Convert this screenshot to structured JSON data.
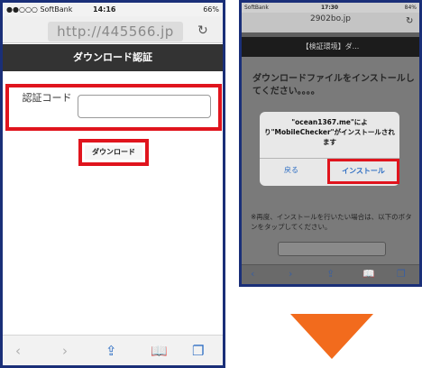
{
  "colors": {
    "highlight": "#e0141d",
    "phone_frame": "#1a2f78",
    "arrow": "#f26b1d",
    "link": "#2f6fc4"
  },
  "left_phone": {
    "status": {
      "carrier": "●●○○○ SoftBank",
      "time": "14:16",
      "battery": "66%"
    },
    "url": "http://445566.jp",
    "reload_icon": "reload-icon",
    "title": "ダウンロード認証",
    "form": {
      "label": "認証コード",
      "input_value": ""
    },
    "download_button": "ダウンロード",
    "toolbar_icons": [
      "back-icon",
      "forward-icon",
      "share-icon",
      "bookmarks-icon",
      "tabs-icon"
    ]
  },
  "right_phone": {
    "status": {
      "carrier": "SoftBank",
      "time": "17:30",
      "battery": "84%"
    },
    "url": "2902bo.jp",
    "title": "【検証環境】ダ...",
    "background_text": "ダウンロードファイルをインストールしてください。。。。",
    "background_note": "※再度、インストールを行いたい場合は、以下のボタンをタップしてください。",
    "dialog": {
      "message": "\"ocean1367.me\"により\"MobileChecker\"がインストールされます",
      "back_button": "戻る",
      "install_button": "インストール"
    },
    "toolbar_icons": [
      "back-icon",
      "forward-icon",
      "share-icon",
      "bookmarks-icon",
      "tabs-icon"
    ]
  }
}
